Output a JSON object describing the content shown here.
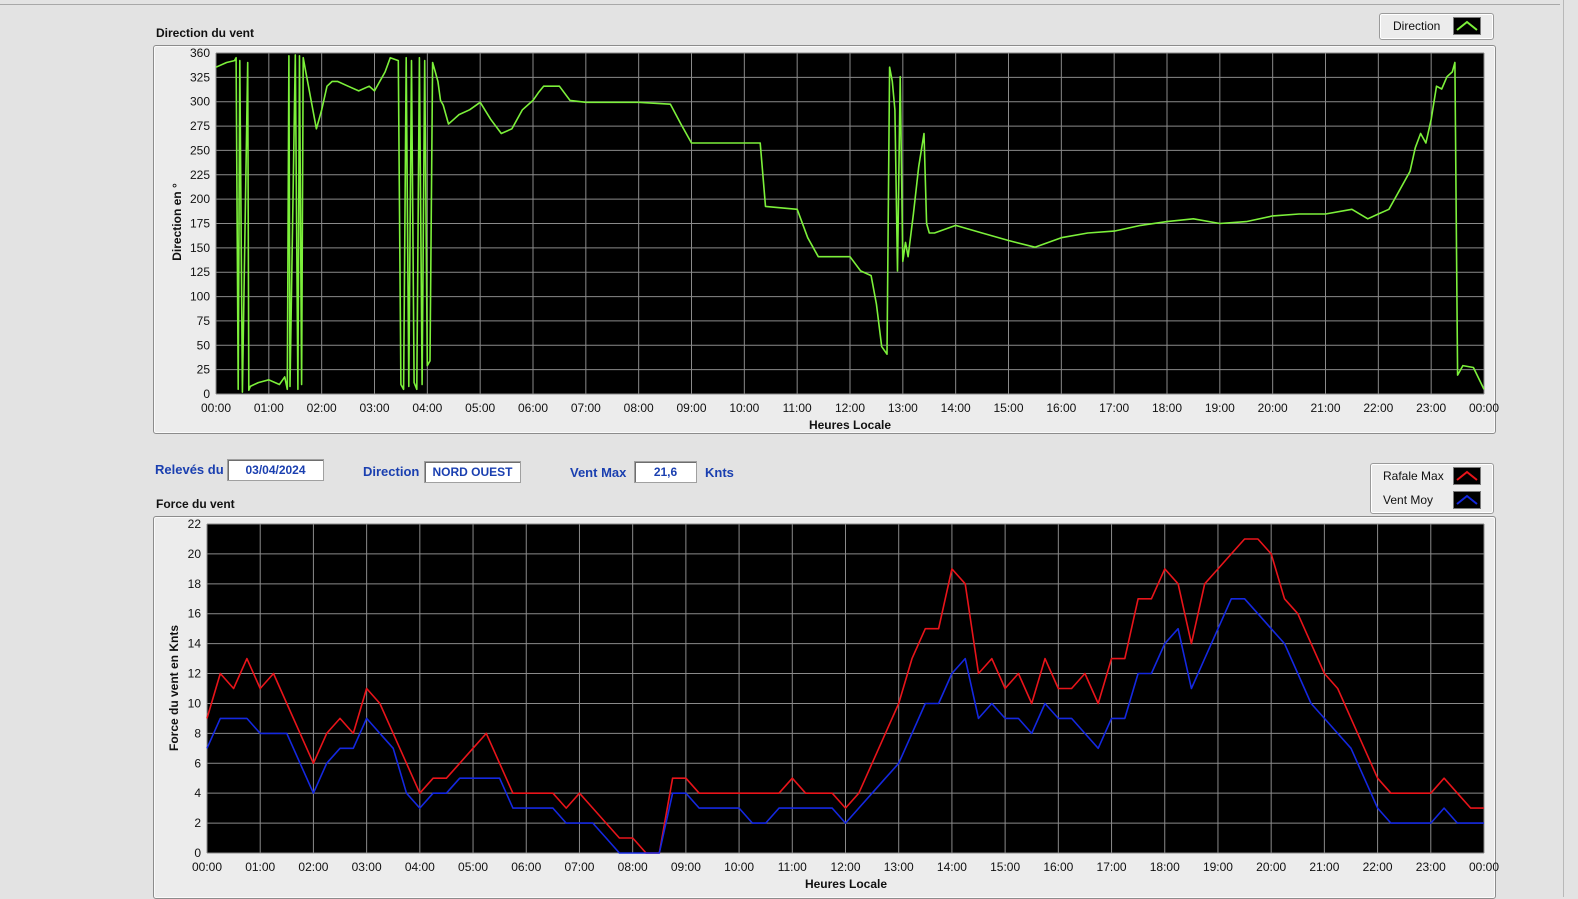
{
  "top_panel": {
    "title": "Direction du vent"
  },
  "bottom_panel": {
    "title": "Force du vent"
  },
  "info": {
    "date_label": "Relevés du",
    "date_value": "03/04/2024",
    "direction_label": "Direction",
    "direction_value": "NORD OUEST",
    "vent_max_label": "Vent Max",
    "vent_max_value": "21,6",
    "unit": "Knts"
  },
  "colors": {
    "direction": "#7cf03a",
    "rafale": "#e8141a",
    "vent": "#1428e0",
    "grid": "#8a8a8a"
  },
  "chart_data": [
    {
      "type": "line",
      "title": "Direction du vent",
      "xlabel": "Heures Locale",
      "ylabel": "Direction en °",
      "ylim": [
        0,
        360
      ],
      "xlim": [
        0,
        24
      ],
      "yticks": [
        "0",
        "25",
        "50",
        "75",
        "100",
        "125",
        "150",
        "175",
        "200",
        "225",
        "250",
        "275",
        "300",
        "325",
        "360"
      ],
      "xticks": [
        "00:00",
        "01:00",
        "02:00",
        "03:00",
        "04:00",
        "05:00",
        "06:00",
        "07:00",
        "08:00",
        "09:00",
        "10:00",
        "11:00",
        "12:00",
        "13:00",
        "14:00",
        "15:00",
        "16:00",
        "17:00",
        "18:00",
        "19:00",
        "20:00",
        "21:00",
        "22:00",
        "23:00",
        "00:00"
      ],
      "grid": true,
      "legend": "top-right",
      "series": [
        {
          "name": "Direction",
          "x": [
            0,
            0.2,
            0.35,
            0.38,
            0.42,
            0.45,
            0.5,
            0.6,
            0.62,
            0.65,
            0.8,
            1.0,
            1.2,
            1.3,
            1.35,
            1.38,
            1.4,
            1.5,
            1.55,
            1.58,
            1.62,
            1.65,
            1.7,
            1.8,
            1.9,
            2.0,
            2.1,
            2.2,
            2.3,
            2.5,
            2.7,
            2.9,
            3.0,
            3.1,
            3.2,
            3.3,
            3.45,
            3.5,
            3.55,
            3.6,
            3.65,
            3.7,
            3.75,
            3.8,
            3.85,
            3.9,
            3.95,
            4.0,
            4.05,
            4.1,
            4.15,
            4.2,
            4.25,
            4.3,
            4.4,
            4.5,
            4.6,
            4.8,
            5.0,
            5.2,
            5.4,
            5.6,
            5.8,
            6.0,
            6.1,
            6.2,
            6.5,
            6.7,
            7.0,
            8.0,
            8.6,
            8.8,
            9.0,
            10.0,
            10.3,
            10.4,
            11.0,
            11.2,
            11.4,
            12.0,
            12.2,
            12.4,
            12.5,
            12.6,
            12.7,
            12.75,
            12.8,
            12.85,
            12.9,
            12.95,
            13.0,
            13.05,
            13.1,
            13.2,
            13.3,
            13.4,
            13.45,
            13.5,
            13.6,
            14.0,
            14.5,
            15.0,
            15.5,
            16.0,
            16.5,
            17.0,
            17.5,
            18.0,
            18.5,
            19.0,
            19.5,
            20.0,
            20.5,
            21.0,
            21.5,
            21.8,
            22.0,
            22.2,
            22.4,
            22.6,
            22.7,
            22.8,
            22.9,
            23.0,
            23.1,
            23.2,
            23.3,
            23.4,
            23.45,
            23.5,
            23.6,
            23.8,
            24.0
          ],
          "values": [
            345,
            350,
            352,
            355,
            5,
            352,
            2,
            350,
            4,
            8,
            12,
            15,
            10,
            18,
            5,
            357,
            8,
            358,
            5,
            357,
            10,
            355,
            340,
            310,
            280,
            300,
            325,
            330,
            330,
            325,
            320,
            325,
            320,
            330,
            340,
            355,
            352,
            10,
            5,
            355,
            8,
            352,
            12,
            5,
            355,
            10,
            352,
            30,
            35,
            350,
            340,
            330,
            310,
            305,
            285,
            290,
            295,
            300,
            308,
            290,
            275,
            280,
            300,
            310,
            318,
            325,
            325,
            310,
            308,
            308,
            306,
            285,
            265,
            265,
            265,
            198,
            195,
            165,
            145,
            145,
            130,
            125,
            95,
            50,
            42,
            345,
            330,
            300,
            130,
            335,
            140,
            160,
            145,
            190,
            240,
            275,
            180,
            170,
            170,
            178,
            170,
            162,
            155,
            165,
            170,
            172,
            178,
            182,
            185,
            180,
            182,
            188,
            190,
            190,
            195,
            185,
            190,
            195,
            215,
            235,
            260,
            275,
            265,
            290,
            325,
            322,
            335,
            340,
            350,
            20,
            30,
            28,
            5
          ],
          "color": "#7cf03a"
        }
      ]
    },
    {
      "type": "line",
      "title": "Force du vent",
      "xlabel": "Heures Locale",
      "ylabel": "Force du vent en Knts",
      "ylim": [
        0,
        22
      ],
      "xlim": [
        0,
        24
      ],
      "yticks": [
        "0",
        "2",
        "4",
        "6",
        "8",
        "10",
        "12",
        "14",
        "16",
        "18",
        "20",
        "22"
      ],
      "xticks": [
        "00:00",
        "01:00",
        "02:00",
        "03:00",
        "04:00",
        "05:00",
        "06:00",
        "07:00",
        "08:00",
        "09:00",
        "10:00",
        "11:00",
        "12:00",
        "13:00",
        "14:00",
        "15:00",
        "16:00",
        "17:00",
        "18:00",
        "19:00",
        "20:00",
        "21:00",
        "22:00",
        "23:00",
        "00:00"
      ],
      "grid": true,
      "legend": "top-right",
      "series": [
        {
          "name": "Rafale Max",
          "color": "#e8141a",
          "x": [
            0,
            0.25,
            0.5,
            0.75,
            1.0,
            1.25,
            1.5,
            1.75,
            2.0,
            2.25,
            2.5,
            2.75,
            3.0,
            3.25,
            3.5,
            3.75,
            4.0,
            4.25,
            4.5,
            4.75,
            5.0,
            5.25,
            5.5,
            5.75,
            6.0,
            6.25,
            6.5,
            6.75,
            7.0,
            7.25,
            7.5,
            7.75,
            8.0,
            8.25,
            8.5,
            8.75,
            9.0,
            9.25,
            9.5,
            9.75,
            10.0,
            10.25,
            10.5,
            10.75,
            11.0,
            11.25,
            11.5,
            11.75,
            12.0,
            12.25,
            12.5,
            12.75,
            13.0,
            13.25,
            13.5,
            13.75,
            14.0,
            14.25,
            14.5,
            14.75,
            15.0,
            15.25,
            15.5,
            15.75,
            16.0,
            16.25,
            16.5,
            16.75,
            17.0,
            17.25,
            17.5,
            17.75,
            18.0,
            18.25,
            18.5,
            18.75,
            19.0,
            19.25,
            19.5,
            19.75,
            20.0,
            20.25,
            20.5,
            20.75,
            21.0,
            21.25,
            21.5,
            21.75,
            22.0,
            22.25,
            22.5,
            22.75,
            23.0,
            23.25,
            23.5,
            23.75,
            24.0
          ],
          "values": [
            9,
            12,
            11,
            13,
            11,
            12,
            10,
            8,
            6,
            8,
            9,
            8,
            11,
            10,
            8,
            6,
            4,
            5,
            5,
            6,
            7,
            8,
            6,
            4,
            4,
            4,
            4,
            3,
            4,
            3,
            2,
            1,
            1,
            0,
            0,
            5,
            5,
            4,
            4,
            4,
            4,
            4,
            4,
            4,
            5,
            4,
            4,
            4,
            3,
            4,
            6,
            8,
            10,
            13,
            15,
            15,
            19,
            18,
            12,
            13,
            11,
            12,
            10,
            13,
            11,
            11,
            12,
            10,
            13,
            13,
            17,
            17,
            19,
            18,
            14,
            18,
            19,
            20,
            21,
            21,
            20,
            17,
            16,
            14,
            12,
            11,
            9,
            7,
            5,
            4,
            4,
            4,
            4,
            5,
            4,
            3,
            3
          ]
        },
        {
          "name": "Vent Moy",
          "color": "#1428e0",
          "x": [
            0,
            0.25,
            0.5,
            0.75,
            1.0,
            1.25,
            1.5,
            1.75,
            2.0,
            2.25,
            2.5,
            2.75,
            3.0,
            3.25,
            3.5,
            3.75,
            4.0,
            4.25,
            4.5,
            4.75,
            5.0,
            5.25,
            5.5,
            5.75,
            6.0,
            6.25,
            6.5,
            6.75,
            7.0,
            7.25,
            7.5,
            7.75,
            8.0,
            8.25,
            8.5,
            8.75,
            9.0,
            9.25,
            9.5,
            9.75,
            10.0,
            10.25,
            10.5,
            10.75,
            11.0,
            11.25,
            11.5,
            11.75,
            12.0,
            12.25,
            12.5,
            12.75,
            13.0,
            13.25,
            13.5,
            13.75,
            14.0,
            14.25,
            14.5,
            14.75,
            15.0,
            15.25,
            15.5,
            15.75,
            16.0,
            16.25,
            16.5,
            16.75,
            17.0,
            17.25,
            17.5,
            17.75,
            18.0,
            18.25,
            18.5,
            18.75,
            19.0,
            19.25,
            19.5,
            19.75,
            20.0,
            20.25,
            20.5,
            20.75,
            21.0,
            21.25,
            21.5,
            21.75,
            22.0,
            22.25,
            22.5,
            22.75,
            23.0,
            23.25,
            23.5,
            23.75,
            24.0
          ],
          "values": [
            7,
            9,
            9,
            9,
            8,
            8,
            8,
            6,
            4,
            6,
            7,
            7,
            9,
            8,
            7,
            4,
            3,
            4,
            4,
            5,
            5,
            5,
            5,
            3,
            3,
            3,
            3,
            2,
            2,
            2,
            1,
            0,
            0,
            0,
            0,
            4,
            4,
            3,
            3,
            3,
            3,
            2,
            2,
            3,
            3,
            3,
            3,
            3,
            2,
            3,
            4,
            5,
            6,
            8,
            10,
            10,
            12,
            13,
            9,
            10,
            9,
            9,
            8,
            10,
            9,
            9,
            8,
            7,
            9,
            9,
            12,
            12,
            14,
            15,
            11,
            13,
            15,
            17,
            17,
            16,
            15,
            14,
            12,
            10,
            9,
            8,
            7,
            5,
            3,
            2,
            2,
            2,
            2,
            3,
            2,
            2,
            2
          ]
        }
      ]
    }
  ]
}
